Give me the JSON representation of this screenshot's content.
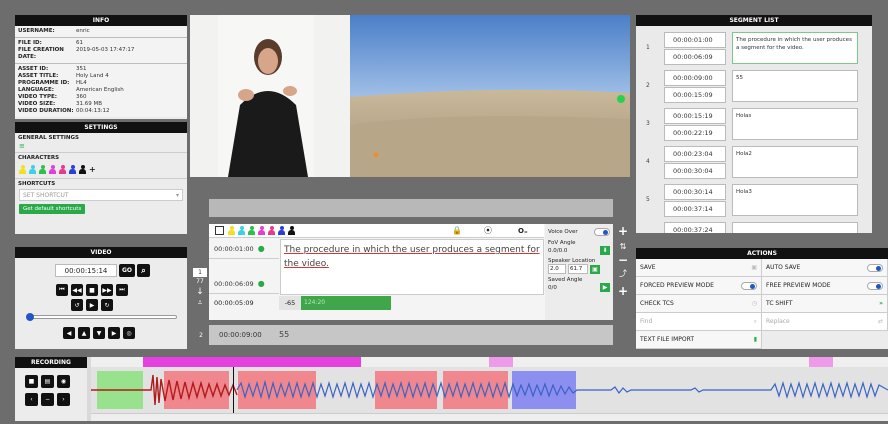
{
  "info": {
    "title": "INFO",
    "username_label": "USERNAME:",
    "username": "enric",
    "file_id_label": "FILE ID:",
    "file_id": "61",
    "file_date_label": "FILE CREATION DATE:",
    "file_date": "2019-05-03 17:47:17",
    "asset_id_label": "ASSET ID:",
    "asset_id": "351",
    "asset_title_label": "ASSET TITLE:",
    "asset_title": "Holy Land 4",
    "programme_id_label": "PROGRAMME ID:",
    "programme_id": "HL4",
    "language_label": "LANGUAGE:",
    "language": "American English",
    "video_type_label": "VIDEO TYPE:",
    "video_type": "360",
    "video_size_label": "VIDEO SIZE:",
    "video_size": "31.69 MB",
    "video_duration_label": "VIDEO DURATION:",
    "video_duration": "00:04:13:12"
  },
  "settings": {
    "title": "SETTINGS",
    "general_label": "GENERAL SETTINGS",
    "characters_label": "CHARACTERS",
    "character_colors": [
      "#f0e020",
      "#3fd0e8",
      "#2fbf4f",
      "#e03fd8",
      "#e83a8a",
      "#2a3ed8",
      "#111111"
    ],
    "add_character": "+",
    "shortcuts_label": "SHORTCUTS",
    "shortcut_placeholder": "SET SHORTCUT",
    "default_shortcuts_btn": "Get default shortcuts"
  },
  "video": {
    "title": "VIDEO",
    "timecode": "00:00:15:14",
    "go_btn": "GO"
  },
  "recording": {
    "title": "RECORDING"
  },
  "editor": {
    "character_colors": [
      "#f0e020",
      "#3fd0e8",
      "#2fbf4f",
      "#e03fd8",
      "#e83a8a",
      "#2a3ed8",
      "#111111"
    ],
    "segment_index": "1",
    "segment_count": "77",
    "tc_in": "00:00:01:00",
    "tc_out": "00:00:06:09",
    "duration": "00:00:05:09",
    "char_count": "-65",
    "cps": "124:20",
    "text": "The procedure in which the user produces a segment for the video.",
    "voice_over_label": "Voice Over",
    "fov_angle_label": "FoV Angle",
    "fov_angle": "0.0/0.0",
    "speaker_location_label": "Speaker Location",
    "speaker_x": "2.0",
    "speaker_y": "61.7",
    "saved_angle_label": "Saved Angle",
    "saved_angle": "0/0",
    "next_index": "2",
    "next_tc": "00:00:09:00",
    "next_text": "55"
  },
  "segment_list": {
    "title": "SEGMENT LIST",
    "rows": [
      {
        "num": "1",
        "tc_in": "00:00:01:00",
        "tc_out": "00:00:06:09",
        "text": "The procedure in which the user produces a segment for the video."
      },
      {
        "num": "2",
        "tc_in": "00:00:09:00",
        "tc_out": "00:00:15:09",
        "text": "55"
      },
      {
        "num": "3",
        "tc_in": "00:00:15:19",
        "tc_out": "00:00:22:19",
        "text": "Holas"
      },
      {
        "num": "4",
        "tc_in": "00:00:23:04",
        "tc_out": "00:00:30:04",
        "text": "Hola2"
      },
      {
        "num": "5",
        "tc_in": "00:00:30:14",
        "tc_out": "00:00:37:14",
        "text": "Hola3"
      },
      {
        "num": "6",
        "tc_in": "00:00:37:24",
        "tc_out": "",
        "text": ""
      }
    ]
  },
  "actions": {
    "title": "ACTIONS",
    "save": "SAVE",
    "auto_save": "AUTO SAVE",
    "forced_preview": "FORCED PREVIEW MODE",
    "free_preview": "FREE PREVIEW MODE",
    "check_tcs": "CHECK TCS",
    "tc_shift": "TC SHIFT",
    "find_placeholder": "Find",
    "replace_placeholder": "Replace",
    "text_file_import": "TEXT FILE IMPORT"
  }
}
